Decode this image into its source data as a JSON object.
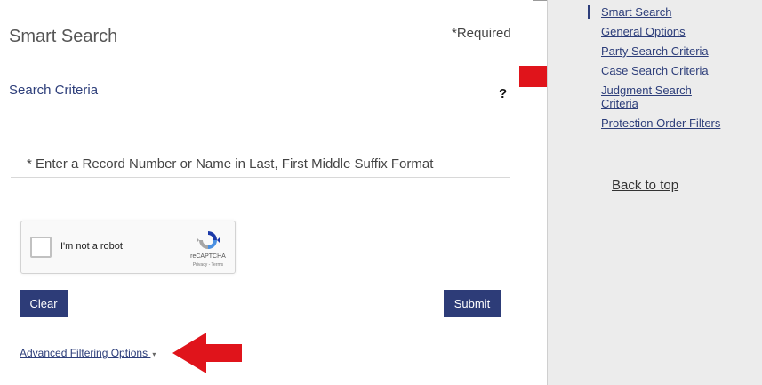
{
  "main": {
    "title": "Smart Search",
    "required_note": "*Required",
    "section_title": "Search Criteria",
    "help_symbol": "?",
    "search": {
      "placeholder": "* Enter a Record Number or Name in Last, First Middle Suffix Format",
      "value": ""
    },
    "recaptcha": {
      "label": "I'm not a robot",
      "brand": "reCAPTCHA",
      "links": "Privacy - Terms"
    },
    "buttons": {
      "clear": "Clear",
      "submit": "Submit"
    },
    "advanced_link": "Advanced Filtering Options",
    "advanced_caret": "▾"
  },
  "sidebar": {
    "items": [
      {
        "label": "Smart Search",
        "active": true
      },
      {
        "label": "General Options"
      },
      {
        "label": "Party Search Criteria"
      },
      {
        "label": "Case Search Criteria"
      },
      {
        "label": "Judgment Search Criteria"
      },
      {
        "label": "Protection Order Filters"
      }
    ],
    "back_to_top": "Back to top"
  },
  "colors": {
    "accent": "#2d3c78",
    "arrow": "#e0141b",
    "sidebar_bg": "#ececec"
  },
  "icons": [
    "help-icon",
    "recaptcha-logo-icon",
    "caret-down-icon",
    "red-arrow-icon"
  ]
}
